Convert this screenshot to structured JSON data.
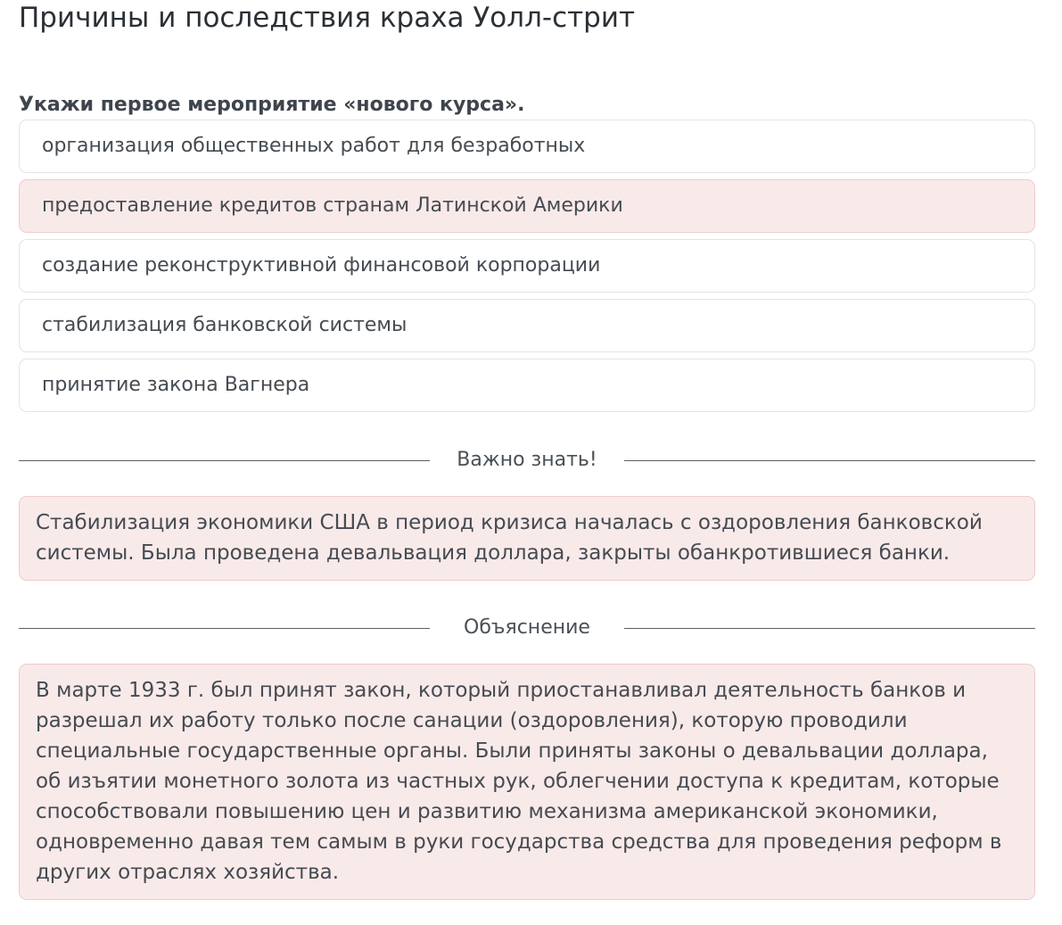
{
  "page": {
    "title": "Причины и последствия краха Уолл-стрит"
  },
  "question": {
    "text": "Укажи первое мероприятие «нового курса».",
    "options": [
      {
        "label": "организация общественных работ для безработных",
        "selected": false
      },
      {
        "label": "предоставление кредитов странам Латинской Америки",
        "selected": true
      },
      {
        "label": "создание реконструктивной финансовой корпорации",
        "selected": false
      },
      {
        "label": "стабилизация банковской системы",
        "selected": false
      },
      {
        "label": "принятие закона Вагнера",
        "selected": false
      }
    ]
  },
  "important": {
    "heading": "Важно знать!",
    "text": "Стабилизация экономики США в период кризиса началась с оздоровления банковской системы. Была проведена девальвация доллара, закрыты обанкротившиеся банки."
  },
  "explanation": {
    "heading": "Объяснение",
    "text": "В марте 1933 г. был принят закон, который приостанавливал деятельность банков и разрешал их работу только после санации (оздоровления), которую проводили специальные государственные органы. Были приняты законы о девальвации доллара, об изъятии монетного золота из частных рук, облегчении доступа к кредитам, которые способствовали повышению цен и развитию механизма американской экономики, одновременно давая тем самым в руки государства средства для проведения реформ в других отраслях хозяйства."
  },
  "colors": {
    "selected_background": "#f9eaea",
    "selected_border": "#efcccc",
    "option_border": "#e2e4e6",
    "text": "#454b51"
  }
}
